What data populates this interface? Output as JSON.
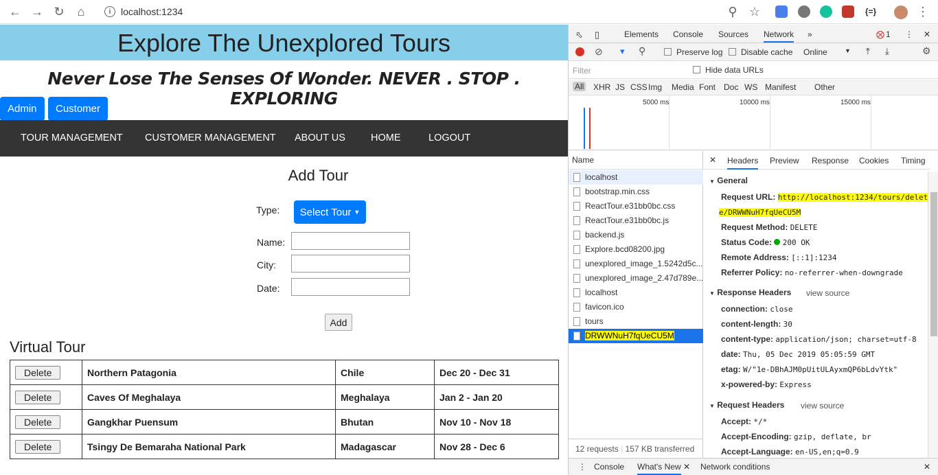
{
  "browser": {
    "url": "localhost:1234"
  },
  "site": {
    "banner": "Explore The Unexplored Tours",
    "tagline": "Never Lose The Senses Of Wonder. NEVER . STOP . EXPLORING",
    "roles": [
      "Admin",
      "Customer"
    ],
    "nav": [
      "TOUR MANAGEMENT",
      "CUSTOMER MANAGEMENT",
      "ABOUT US",
      "HOME",
      "LOGOUT"
    ],
    "form": {
      "title": "Add Tour",
      "type_label": "Type:",
      "select_label": "Select Tour",
      "name_label": "Name:",
      "city_label": "City:",
      "date_label": "Date:",
      "add_label": "Add"
    },
    "virtual_title": "Virtual Tour",
    "delete_label": "Delete",
    "tours": [
      {
        "name": "Northern Patagonia",
        "place": "Chile",
        "dates": "Dec 20 - Dec 31"
      },
      {
        "name": "Caves Of Meghalaya",
        "place": "Meghalaya",
        "dates": "Jan 2 - Jan 20"
      },
      {
        "name": "Gangkhar Puensum",
        "place": "Bhutan",
        "dates": "Nov 10 - Nov 18"
      },
      {
        "name": "Tsingy De Bemaraha National Park",
        "place": "Madagascar",
        "dates": "Nov 28 - Dec 6"
      }
    ]
  },
  "devtools": {
    "tabs": [
      "Elements",
      "Console",
      "Sources",
      "Network"
    ],
    "error_count": "1",
    "preserve_log": "Preserve log",
    "disable_cache": "Disable cache",
    "throttle": "Online",
    "filter_placeholder": "Filter",
    "hide_data_urls": "Hide data URLs",
    "types": [
      "All",
      "XHR",
      "JS",
      "CSS",
      "Img",
      "Media",
      "Font",
      "Doc",
      "WS",
      "Manifest",
      "Other"
    ],
    "timeline_ticks": [
      "5000 ms",
      "10000 ms",
      "15000 ms"
    ],
    "name_header": "Name",
    "requests": [
      "localhost",
      "bootstrap.min.css",
      "ReactTour.e31bb0bc.css",
      "ReactTour.e31bb0bc.js",
      "backend.js",
      "Explore.bcd08200.jpg",
      "unexplored_image_1.5242d5c...",
      "unexplored_image_2.47d789e...",
      "localhost",
      "favicon.ico",
      "tours",
      "DRWWNuH7fqUeCU5M"
    ],
    "detail_tabs": [
      "Headers",
      "Preview",
      "Response",
      "Cookies",
      "Timing"
    ],
    "general_title": "General",
    "request_url_key": "Request URL:",
    "request_url_1": "http://localhost:1234/tours/delet",
    "request_url_2": "e/DRWWNuH7fqUeCU5M",
    "request_method_key": "Request Method:",
    "request_method": "DELETE",
    "status_code_key": "Status Code:",
    "status_code": "200 OK",
    "remote_key": "Remote Address:",
    "remote": "[::1]:1234",
    "referrer_key": "Referrer Policy:",
    "referrer": "no-referrer-when-downgrade",
    "resp_headers_title": "Response Headers",
    "view_source": "view source",
    "resp_headers": [
      {
        "k": "connection:",
        "v": "close"
      },
      {
        "k": "content-length:",
        "v": "30"
      },
      {
        "k": "content-type:",
        "v": "application/json; charset=utf-8"
      },
      {
        "k": "date:",
        "v": "Thu, 05 Dec 2019 05:05:59 GMT"
      },
      {
        "k": "etag:",
        "v": "W/\"1e-DBhAJM0pUitULAyxmQP6bLdvYtk\""
      },
      {
        "k": "x-powered-by:",
        "v": "Express"
      }
    ],
    "req_headers_title": "Request Headers",
    "req_headers": [
      {
        "k": "Accept:",
        "v": "*/*"
      },
      {
        "k": "Accept-Encoding:",
        "v": "gzip, deflate, br"
      },
      {
        "k": "Accept-Language:",
        "v": "en-US,en;q=0.9"
      }
    ],
    "requests_count": "12 requests",
    "transferred": "157 KB transferred",
    "drawer_tabs": [
      "Console",
      "What's New",
      "Network conditions"
    ]
  },
  "colors": {
    "banner": "#87ceeb",
    "primary": "#007bff",
    "nav": "#333333",
    "selected": "#1a73e8",
    "highlight": "#ffff00"
  }
}
